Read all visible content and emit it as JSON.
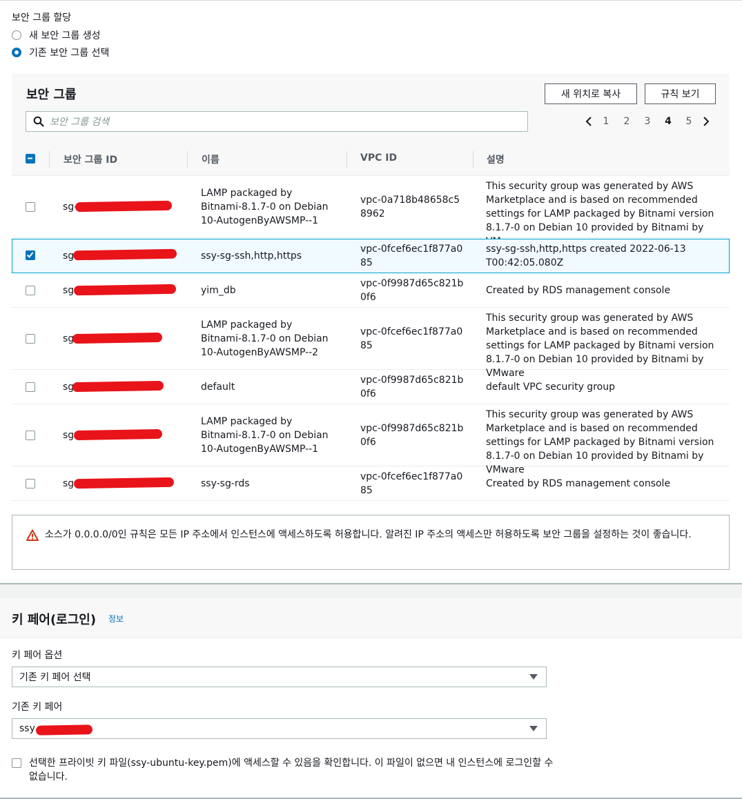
{
  "security_group_assign": {
    "label": "보안 그룹 할당",
    "options": [
      {
        "label": "새 보안 그룹 생성",
        "checked": false
      },
      {
        "label": "기존 보안 그룹 선택",
        "checked": true
      }
    ]
  },
  "sg_panel": {
    "title": "보안 그룹",
    "copy_button": "새 위치로 복사",
    "rules_button": "규칙 보기",
    "search_placeholder": "보안 그룹 검색",
    "pages": [
      "1",
      "2",
      "3",
      "4",
      "5"
    ],
    "current_page": "4",
    "columns": {
      "id": "보안 그룹 ID",
      "name": "이름",
      "vpc": "VPC ID",
      "desc": "설명"
    },
    "rows": [
      {
        "id": "sg-",
        "name": "LAMP packaged by Bitnami-8.1.7-0 on Debian 10-AutogenByAWSMP--1",
        "vpc": "vpc-0a718b48658c58962",
        "desc": "This security group was generated by AWS Marketplace and is based on recommended settings for LAMP packaged by Bitnami version 8.1.7-0 on Debian 10 provided by Bitnami by VMware",
        "checked": false
      },
      {
        "id": "sg",
        "name": "ssy-sg-ssh,http,https",
        "vpc": "vpc-0fcef6ec1f877a085",
        "desc": "ssy-sg-ssh,http,https created 2022-06-13T00:42:05.080Z",
        "checked": true
      },
      {
        "id": "sg",
        "name": "yim_db",
        "vpc": "vpc-0f9987d65c821b0f6",
        "desc": "Created by RDS management console",
        "checked": false
      },
      {
        "id": "sg",
        "name": "LAMP packaged by Bitnami-8.1.7-0 on Debian 10-AutogenByAWSMP--2",
        "vpc": "vpc-0fcef6ec1f877a085",
        "desc": "This security group was generated by AWS Marketplace and is based on recommended settings for LAMP packaged by Bitnami version 8.1.7-0 on Debian 10 provided by Bitnami by VMware",
        "checked": false
      },
      {
        "id": "sg",
        "name": "default",
        "vpc": "vpc-0f9987d65c821b0f6",
        "desc": "default VPC security group",
        "checked": false
      },
      {
        "id": "sg",
        "name": "LAMP packaged by Bitnami-8.1.7-0 on Debian 10-AutogenByAWSMP--1",
        "vpc": "vpc-0f9987d65c821b0f6",
        "desc": "This security group was generated by AWS Marketplace and is based on recommended settings for LAMP packaged by Bitnami version 8.1.7-0 on Debian 10 provided by Bitnami by VMware",
        "checked": false
      },
      {
        "id": "sg",
        "name": "ssy-sg-rds",
        "vpc": "vpc-0fcef6ec1f877a085",
        "desc": "Created by RDS management console",
        "checked": false
      }
    ]
  },
  "warning": {
    "text": "소스가 0.0.0.0/0인 규칙은 모든 IP 주소에서 인스턴스에 액세스하도록 허용합니다. 알려진 IP 주소의 액세스만 허용하도록 보안 그룹을 설정하는 것이 좋습니다."
  },
  "key_pair": {
    "title": "키 페어(로그인)",
    "info": "정보",
    "option_label": "키 페어 옵션",
    "option_value": "기존 키 페어 선택",
    "existing_label": "기존 키 페어",
    "existing_value": "ssy",
    "ack_text": "선택한 프라이빗 키 파일(ssy-ubuntu-key.pem)에 액세스할 수 있음을 확인합니다. 이 파일이 없으면 내 인스턴스에 로그인할 수 없습니다."
  },
  "colors": {
    "accent": "#0073bb",
    "redaction": "#e8141a",
    "selected_row": "#f1faff",
    "warning": "#d13212"
  }
}
